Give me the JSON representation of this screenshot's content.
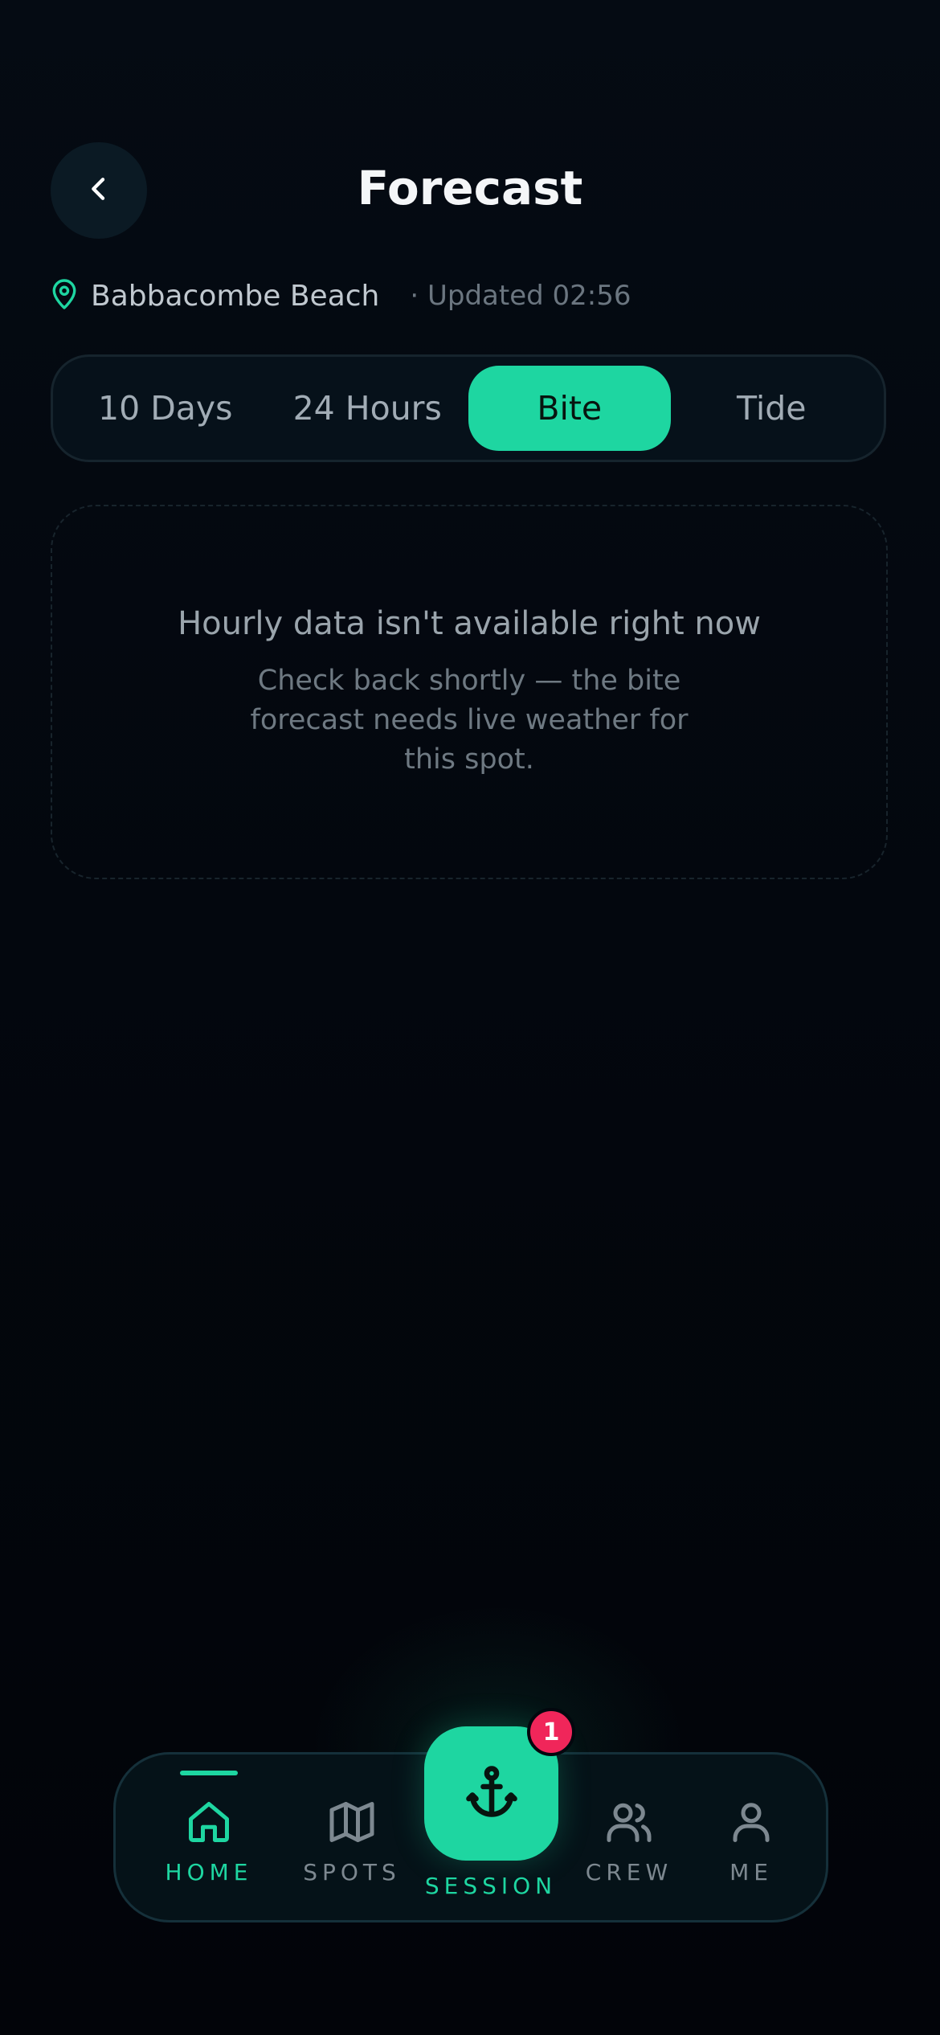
{
  "header": {
    "title": "Forecast",
    "back_icon": "chevron-left-icon"
  },
  "location": {
    "icon": "map-pin-icon",
    "name": "Babbacombe Beach",
    "updated": "· Updated 02:56"
  },
  "tabs": [
    {
      "label": "10 Days",
      "active": false
    },
    {
      "label": "24 Hours",
      "active": false
    },
    {
      "label": "Bite",
      "active": true
    },
    {
      "label": "Tide",
      "active": false
    }
  ],
  "empty_state": {
    "title": "Hourly data isn't available right now",
    "message": "Check back shortly — the bite forecast needs live weather for this spot."
  },
  "nav": {
    "items": [
      {
        "label": "HOME",
        "icon": "home-icon",
        "active": true
      },
      {
        "label": "SPOTS",
        "icon": "map-icon",
        "active": false
      },
      {
        "label": "CREW",
        "icon": "users-icon",
        "active": false
      },
      {
        "label": "ME",
        "icon": "user-icon",
        "active": false
      }
    ],
    "session": {
      "label": "SESSION",
      "icon": "anchor-icon",
      "badge": "1"
    }
  },
  "colors": {
    "accent": "#1ed6a1",
    "badge": "#f0265a",
    "background": "#03070e"
  }
}
